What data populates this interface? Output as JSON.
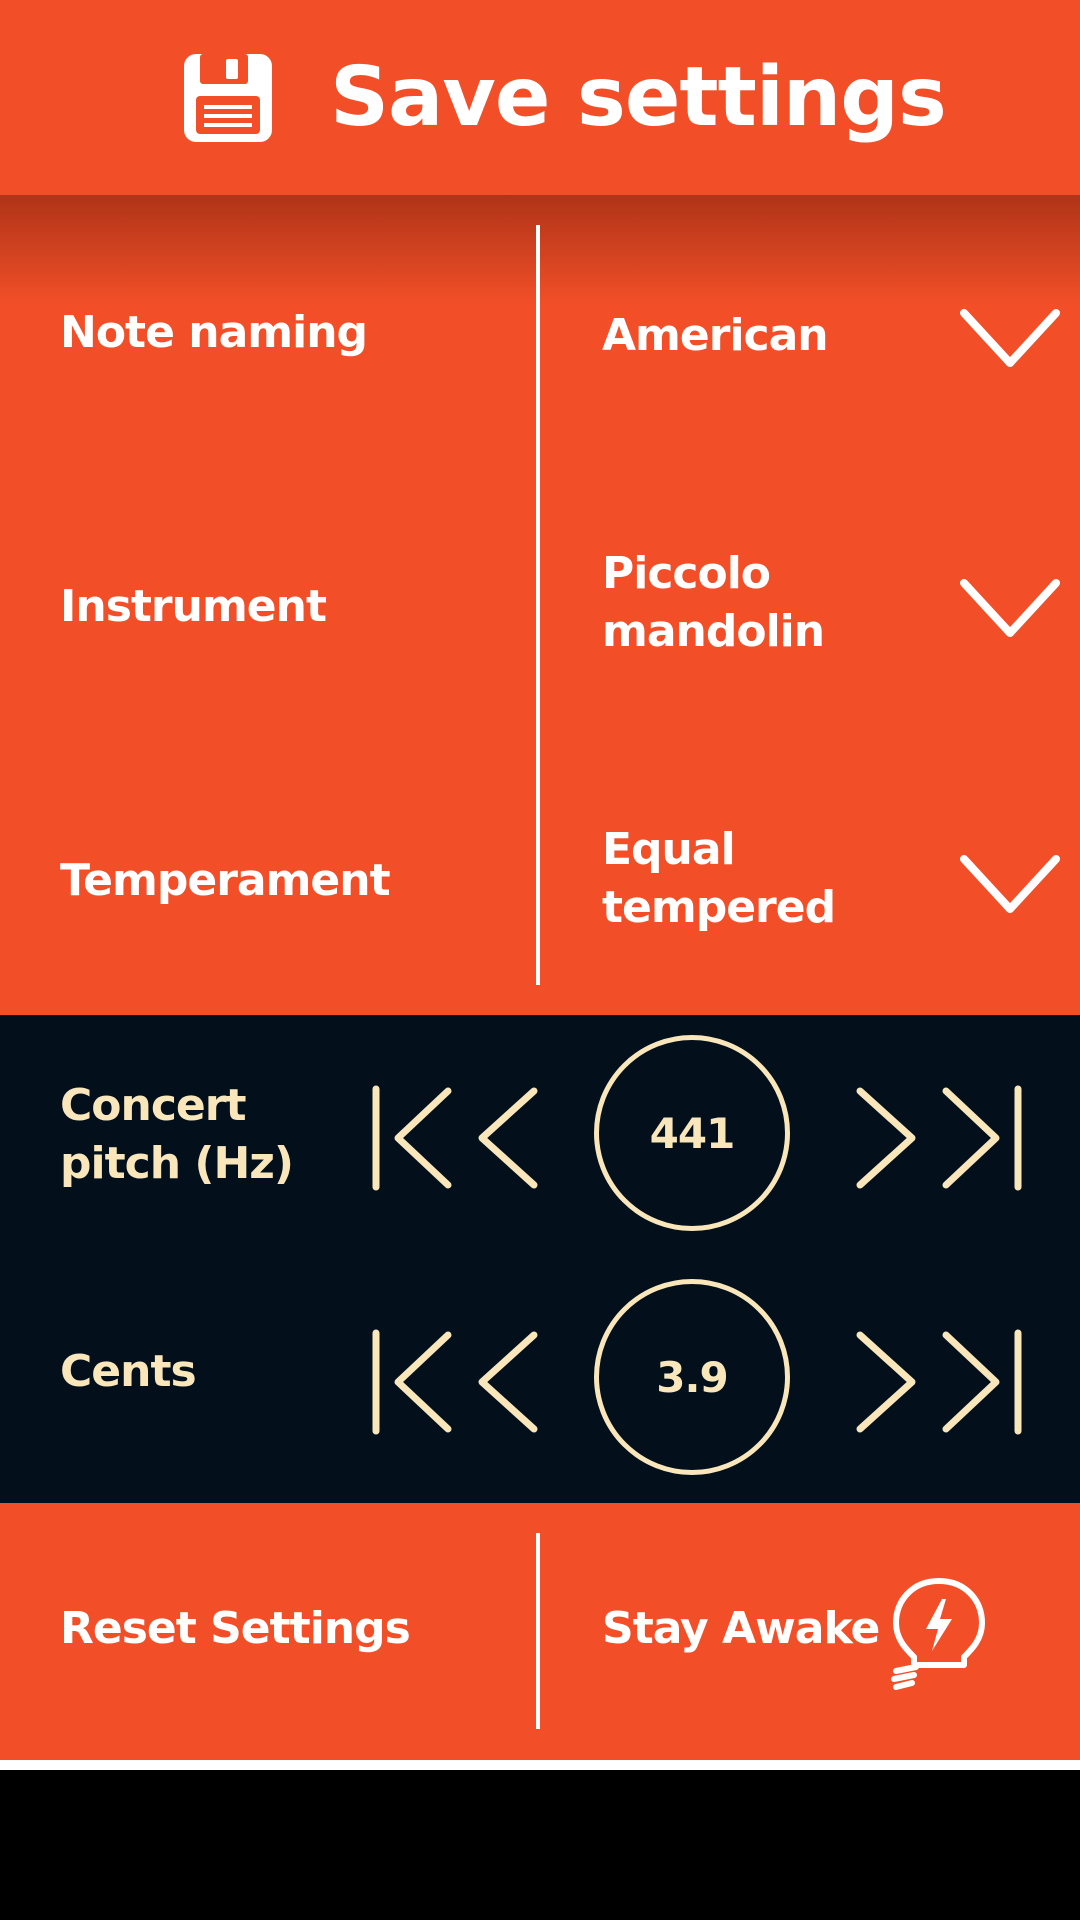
{
  "colors": {
    "accent": "#F24F28",
    "dark_panel": "#03101B",
    "cream": "#F9E7BB",
    "text_light": "#FFFFFF"
  },
  "header": {
    "title": "Save settings",
    "icon": "floppy-disk-icon"
  },
  "settings": {
    "rows": [
      {
        "label": "Note naming",
        "value": "American",
        "icon": "chevron-down-icon"
      },
      {
        "label": "Instrument",
        "value": "Piccolo mandolin",
        "icon": "chevron-down-icon"
      },
      {
        "label": "Temperament",
        "value": "Equal tempered",
        "icon": "chevron-down-icon"
      }
    ]
  },
  "tuning": {
    "concert_pitch": {
      "label": "Concert pitch (Hz)",
      "value": "441",
      "icons": [
        "skip-back-icon",
        "step-back-icon",
        "step-forward-icon",
        "skip-forward-icon"
      ]
    },
    "cents": {
      "label": "Cents",
      "value": "3.9",
      "icons": [
        "skip-back-icon",
        "step-back-icon",
        "step-forward-icon",
        "skip-forward-icon"
      ]
    }
  },
  "bottom": {
    "reset_label": "Reset Settings",
    "stay_awake_label": "Stay Awake",
    "stay_awake_icon": "lightbulb-icon"
  }
}
